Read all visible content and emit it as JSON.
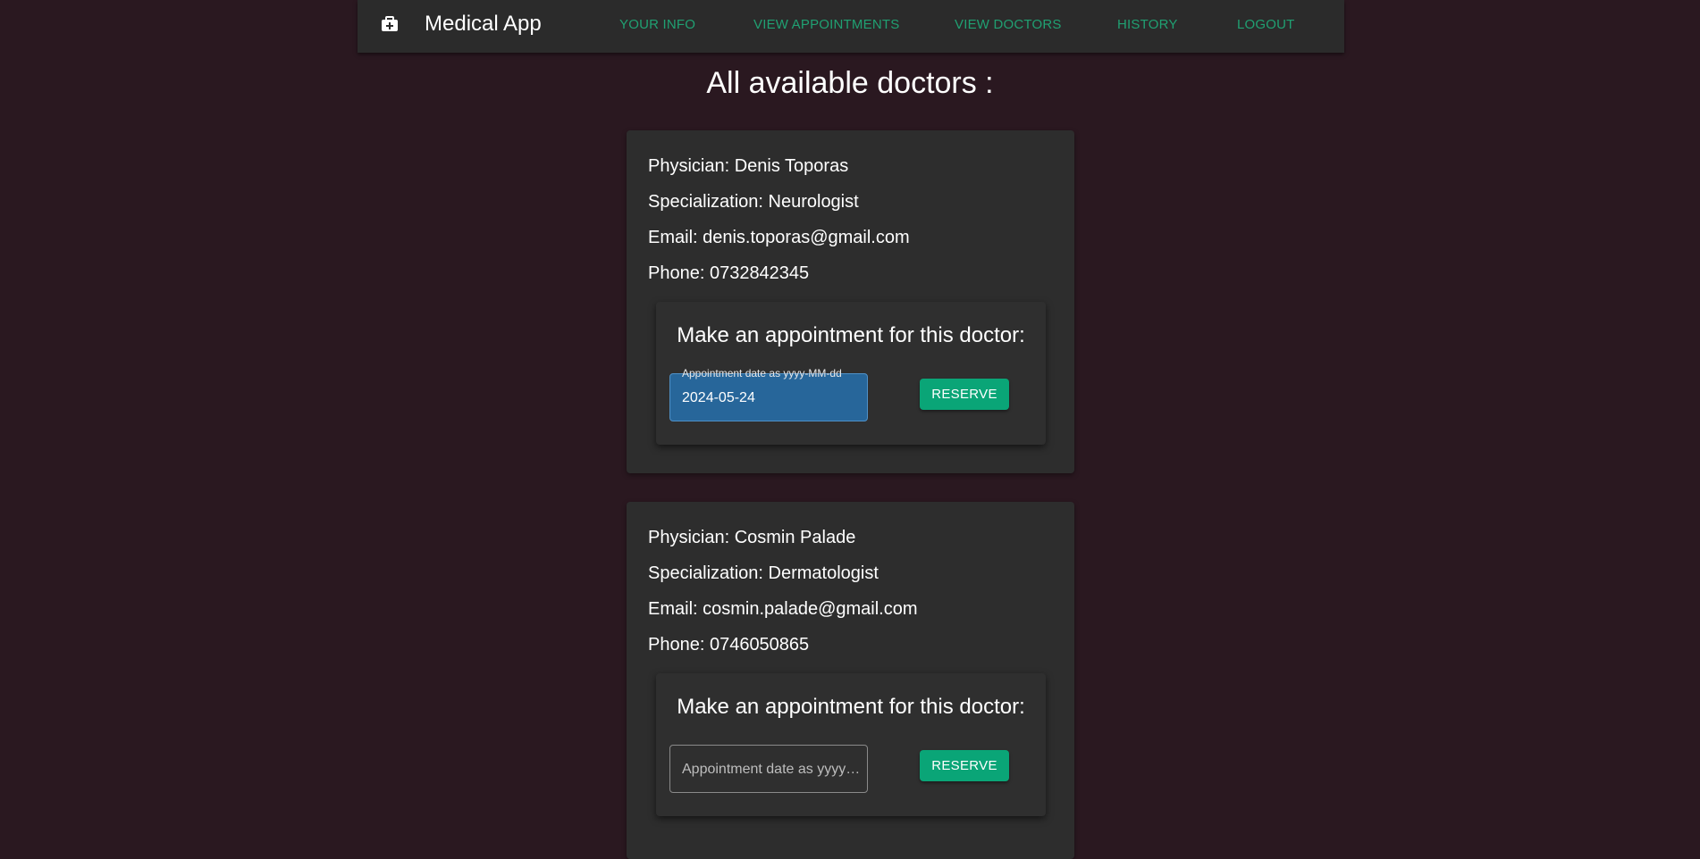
{
  "header": {
    "brand_icon": "medical-kit-icon",
    "title": "Medical App",
    "nav": [
      {
        "label": "YOUR INFO"
      },
      {
        "label": "VIEW APPOINTMENTS"
      },
      {
        "label": "VIEW DOCTORS"
      },
      {
        "label": "HISTORY"
      },
      {
        "label": "LOGOUT"
      }
    ],
    "link_color": "#20a072"
  },
  "page_title": "All available doctors :",
  "doctors": [
    {
      "physician": "Physician: Denis Toporas",
      "specialization": "Specialization: Neurologist",
      "email": "Email: denis.toporas@gmail.com",
      "phone": "Phone: 0732842345",
      "appointment": {
        "heading": "Make an appointment for this doctor:",
        "date_label": "Appointment date as yyyy-MM-dd",
        "date_value": "2024-05-24",
        "reserve_label": "RESERVE"
      }
    },
    {
      "physician": "Physician: Cosmin Palade",
      "specialization": "Specialization: Dermatologist",
      "email": "Email: cosmin.palade@gmail.com",
      "phone": "Phone: 0746050865",
      "appointment": {
        "heading": "Make an appointment for this doctor:",
        "date_placeholder": "Appointment date as yyyy-MM-dd",
        "reserve_label": "RESERVE"
      }
    }
  ],
  "colors": {
    "background": "#2a1820",
    "accent": "#0aa577",
    "filled_input": "#27669a"
  }
}
